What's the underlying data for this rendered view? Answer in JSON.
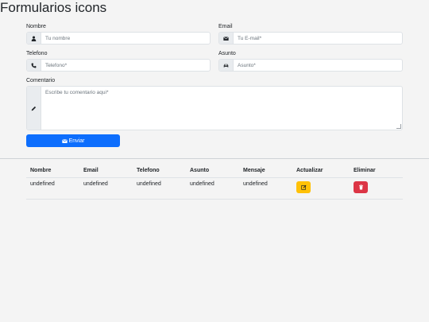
{
  "title": "Formularios icons",
  "form": {
    "nombre": {
      "label": "Nombre",
      "placeholder": "Tu nombre",
      "icon": "user-icon"
    },
    "email": {
      "label": "Email",
      "placeholder": "Tu E-mail*",
      "icon": "envelope-icon"
    },
    "telefono": {
      "label": "Telefono",
      "placeholder": "Telefono*",
      "icon": "phone-icon"
    },
    "asunto": {
      "label": "Asunto",
      "placeholder": "Asunto*",
      "icon": "car-icon"
    },
    "comentario": {
      "label": "Comentario",
      "placeholder": "Escribe tu comentario aqui*",
      "icon": "pencil-icon"
    },
    "submit_label": "Enviar"
  },
  "table": {
    "headers": [
      "Nombre",
      "Email",
      "Telefono",
      "Asunto",
      "Mensaje",
      "Actualizar",
      "Eliminar"
    ],
    "rows": [
      {
        "nombre": "undefined",
        "email": "undefined",
        "telefono": "undefined",
        "asunto": "undefined",
        "mensaje": "undefined"
      }
    ]
  },
  "colors": {
    "primary": "#0d6efd",
    "warning": "#ffc107",
    "danger": "#dc3545"
  }
}
